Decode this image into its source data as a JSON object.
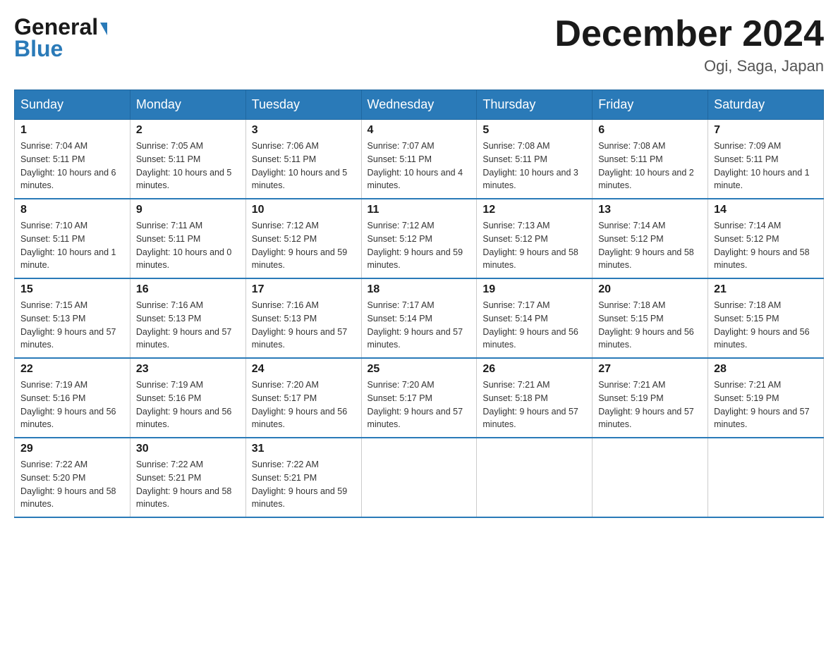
{
  "header": {
    "logo_general": "General",
    "logo_blue": "Blue",
    "month_title": "December 2024",
    "location": "Ogi, Saga, Japan"
  },
  "calendar": {
    "days_of_week": [
      "Sunday",
      "Monday",
      "Tuesday",
      "Wednesday",
      "Thursday",
      "Friday",
      "Saturday"
    ],
    "weeks": [
      [
        {
          "day": "1",
          "sunrise": "7:04 AM",
          "sunset": "5:11 PM",
          "daylight": "10 hours and 6 minutes."
        },
        {
          "day": "2",
          "sunrise": "7:05 AM",
          "sunset": "5:11 PM",
          "daylight": "10 hours and 5 minutes."
        },
        {
          "day": "3",
          "sunrise": "7:06 AM",
          "sunset": "5:11 PM",
          "daylight": "10 hours and 5 minutes."
        },
        {
          "day": "4",
          "sunrise": "7:07 AM",
          "sunset": "5:11 PM",
          "daylight": "10 hours and 4 minutes."
        },
        {
          "day": "5",
          "sunrise": "7:08 AM",
          "sunset": "5:11 PM",
          "daylight": "10 hours and 3 minutes."
        },
        {
          "day": "6",
          "sunrise": "7:08 AM",
          "sunset": "5:11 PM",
          "daylight": "10 hours and 2 minutes."
        },
        {
          "day": "7",
          "sunrise": "7:09 AM",
          "sunset": "5:11 PM",
          "daylight": "10 hours and 1 minute."
        }
      ],
      [
        {
          "day": "8",
          "sunrise": "7:10 AM",
          "sunset": "5:11 PM",
          "daylight": "10 hours and 1 minute."
        },
        {
          "day": "9",
          "sunrise": "7:11 AM",
          "sunset": "5:11 PM",
          "daylight": "10 hours and 0 minutes."
        },
        {
          "day": "10",
          "sunrise": "7:12 AM",
          "sunset": "5:12 PM",
          "daylight": "9 hours and 59 minutes."
        },
        {
          "day": "11",
          "sunrise": "7:12 AM",
          "sunset": "5:12 PM",
          "daylight": "9 hours and 59 minutes."
        },
        {
          "day": "12",
          "sunrise": "7:13 AM",
          "sunset": "5:12 PM",
          "daylight": "9 hours and 58 minutes."
        },
        {
          "day": "13",
          "sunrise": "7:14 AM",
          "sunset": "5:12 PM",
          "daylight": "9 hours and 58 minutes."
        },
        {
          "day": "14",
          "sunrise": "7:14 AM",
          "sunset": "5:12 PM",
          "daylight": "9 hours and 58 minutes."
        }
      ],
      [
        {
          "day": "15",
          "sunrise": "7:15 AM",
          "sunset": "5:13 PM",
          "daylight": "9 hours and 57 minutes."
        },
        {
          "day": "16",
          "sunrise": "7:16 AM",
          "sunset": "5:13 PM",
          "daylight": "9 hours and 57 minutes."
        },
        {
          "day": "17",
          "sunrise": "7:16 AM",
          "sunset": "5:13 PM",
          "daylight": "9 hours and 57 minutes."
        },
        {
          "day": "18",
          "sunrise": "7:17 AM",
          "sunset": "5:14 PM",
          "daylight": "9 hours and 57 minutes."
        },
        {
          "day": "19",
          "sunrise": "7:17 AM",
          "sunset": "5:14 PM",
          "daylight": "9 hours and 56 minutes."
        },
        {
          "day": "20",
          "sunrise": "7:18 AM",
          "sunset": "5:15 PM",
          "daylight": "9 hours and 56 minutes."
        },
        {
          "day": "21",
          "sunrise": "7:18 AM",
          "sunset": "5:15 PM",
          "daylight": "9 hours and 56 minutes."
        }
      ],
      [
        {
          "day": "22",
          "sunrise": "7:19 AM",
          "sunset": "5:16 PM",
          "daylight": "9 hours and 56 minutes."
        },
        {
          "day": "23",
          "sunrise": "7:19 AM",
          "sunset": "5:16 PM",
          "daylight": "9 hours and 56 minutes."
        },
        {
          "day": "24",
          "sunrise": "7:20 AM",
          "sunset": "5:17 PM",
          "daylight": "9 hours and 56 minutes."
        },
        {
          "day": "25",
          "sunrise": "7:20 AM",
          "sunset": "5:17 PM",
          "daylight": "9 hours and 57 minutes."
        },
        {
          "day": "26",
          "sunrise": "7:21 AM",
          "sunset": "5:18 PM",
          "daylight": "9 hours and 57 minutes."
        },
        {
          "day": "27",
          "sunrise": "7:21 AM",
          "sunset": "5:19 PM",
          "daylight": "9 hours and 57 minutes."
        },
        {
          "day": "28",
          "sunrise": "7:21 AM",
          "sunset": "5:19 PM",
          "daylight": "9 hours and 57 minutes."
        }
      ],
      [
        {
          "day": "29",
          "sunrise": "7:22 AM",
          "sunset": "5:20 PM",
          "daylight": "9 hours and 58 minutes."
        },
        {
          "day": "30",
          "sunrise": "7:22 AM",
          "sunset": "5:21 PM",
          "daylight": "9 hours and 58 minutes."
        },
        {
          "day": "31",
          "sunrise": "7:22 AM",
          "sunset": "5:21 PM",
          "daylight": "9 hours and 59 minutes."
        },
        null,
        null,
        null,
        null
      ]
    ]
  }
}
